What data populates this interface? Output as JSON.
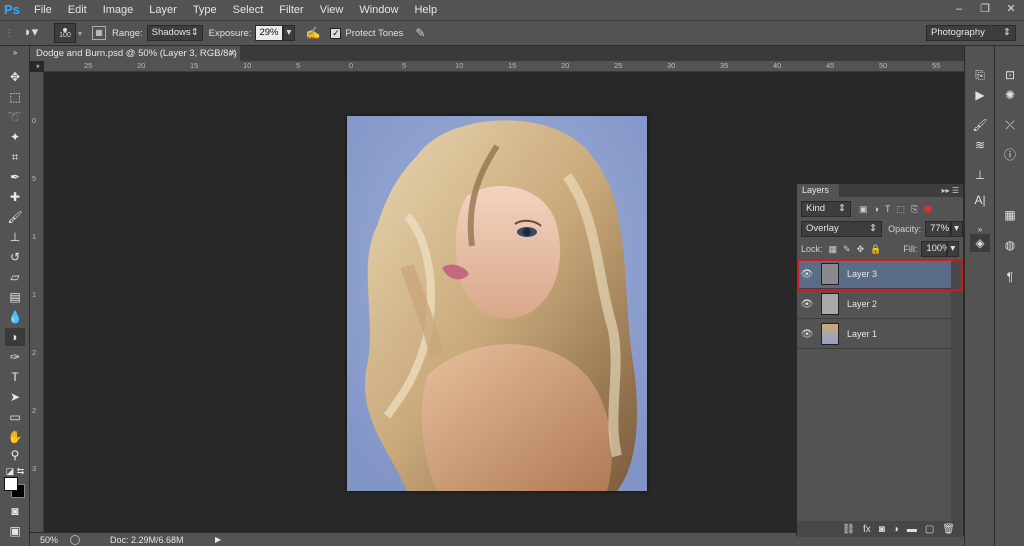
{
  "app": {
    "logo": "Ps"
  },
  "menu": [
    "File",
    "Edit",
    "Image",
    "Layer",
    "Type",
    "Select",
    "Filter",
    "View",
    "Window",
    "Help"
  ],
  "window_controls": [
    "–",
    "❐",
    "✕"
  ],
  "options": {
    "brush_size": "100",
    "range_label": "Range:",
    "range_value": "Shadows",
    "exposure_label": "Exposure:",
    "exposure_value": "29%",
    "protect_tones_label": "Protect Tones",
    "protect_tones_checked": true,
    "workspace": "Photography"
  },
  "document": {
    "tab_title": "Dodge and Burn.psd @ 50% (Layer 3, RGB/8#) *",
    "zoom": "50%",
    "doc_info": "Doc: 2.29M/6.68M"
  },
  "rulers": {
    "top": [
      "25",
      "20",
      "15",
      "10",
      "5",
      "0",
      "5",
      "10",
      "15",
      "20",
      "25",
      "30",
      "35",
      "40",
      "45",
      "50",
      "55"
    ],
    "left": [
      "0",
      "5",
      "1",
      "1",
      "2",
      "2",
      "3"
    ]
  },
  "layers_panel": {
    "title": "Layers",
    "filter_kind": "Kind",
    "blend_mode": "Overlay",
    "opacity_label": "Opacity:",
    "opacity_value": "77%",
    "lock_label": "Lock:",
    "fill_label": "Fill:",
    "fill_value": "100%",
    "layers": [
      {
        "name": "Layer 3",
        "selected": true
      },
      {
        "name": "Layer 2",
        "selected": false
      },
      {
        "name": "Layer 1",
        "selected": false
      }
    ]
  },
  "colors": {
    "selection_highlight": "#d11a1a",
    "selected_row": "#5b6d86",
    "photo_background": "#8fa0cf"
  }
}
